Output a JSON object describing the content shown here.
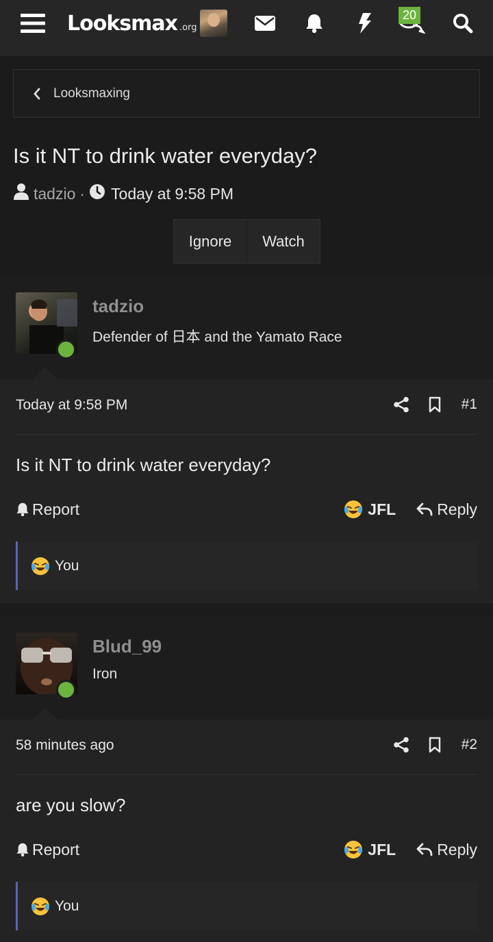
{
  "header": {
    "logo_text": "Looksmax",
    "logo_suffix": ".org",
    "badge_count": "20",
    "icons": [
      "menu-icon",
      "envelope-icon",
      "bell-icon",
      "bolt-icon",
      "conversations-icon",
      "search-icon"
    ],
    "accent": "#6db33f"
  },
  "breadcrumb": {
    "label": "Looksmaxing"
  },
  "thread": {
    "title": "Is it NT to drink water everyday?",
    "author": "tadzio",
    "separator": "·",
    "time": "Today at 9:58 PM",
    "buttons": {
      "ignore": "Ignore",
      "watch": "Watch"
    }
  },
  "posts": [
    {
      "username": "tadzio",
      "user_title": "Defender of 日本 and the Yamato Race",
      "date": "Today at 9:58 PM",
      "number": "#1",
      "text": "Is it NT to drink water everyday?",
      "report_label": "Report",
      "reaction_label": "JFL",
      "reply_label": "Reply",
      "reacted_by": "You"
    },
    {
      "username": "Blud_99",
      "user_title": "Iron",
      "date": "58 minutes ago",
      "number": "#2",
      "text": "are you slow?",
      "report_label": "Report",
      "reaction_label": "JFL",
      "reply_label": "Reply",
      "reacted_by": "You"
    }
  ],
  "colors": {
    "background": "#1b1b1b",
    "online": "#6db33f",
    "reaction_bar_border": "#5a64b8"
  }
}
